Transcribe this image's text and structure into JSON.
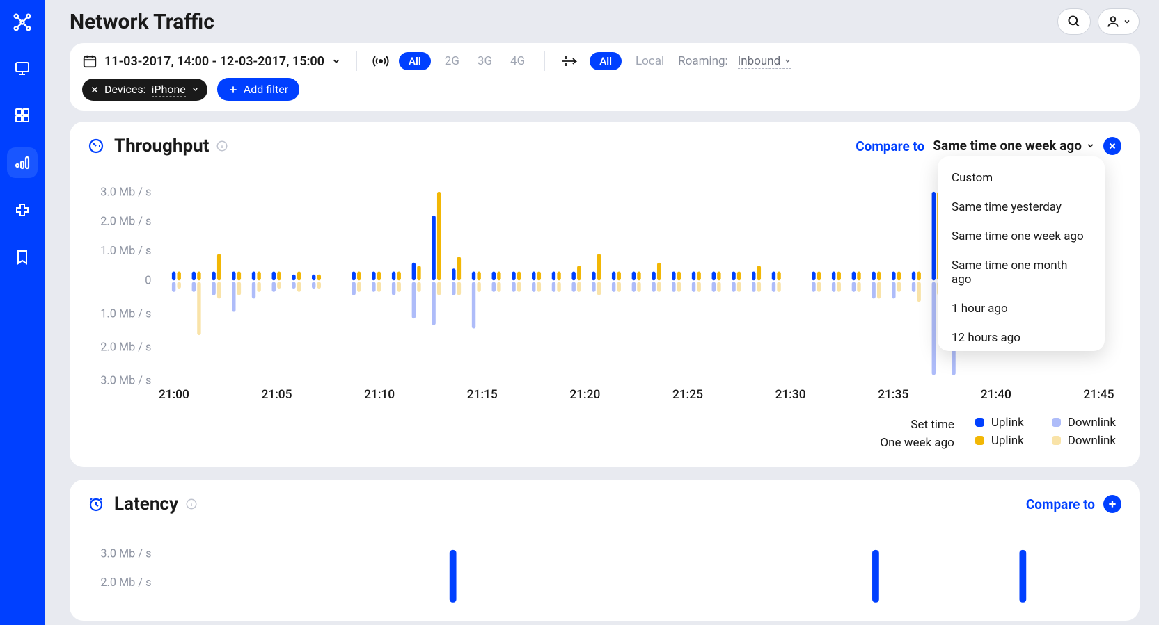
{
  "page_title": "Network Traffic",
  "date_range": "11-03-2017, 14:00 - 12-03-2017, 15:00",
  "network_filter": {
    "all": "All",
    "options": [
      "2G",
      "3G",
      "4G"
    ]
  },
  "roaming_filter": {
    "all": "All",
    "local": "Local",
    "roaming_label": "Roaming:",
    "roaming_value": "Inbound"
  },
  "device_filter": {
    "label": "Devices:",
    "value": "iPhone"
  },
  "add_filter": "Add filter",
  "throughput": {
    "title": "Throughput",
    "compare_label": "Compare to",
    "compare_value": "Same time one week ago",
    "legend": {
      "row1_label": "Set time",
      "row2_label": "One week ago",
      "uplink": "Uplink",
      "downlink": "Downlink"
    }
  },
  "latency": {
    "title": "Latency",
    "compare_label": "Compare to"
  },
  "dropdown_options": [
    "Custom",
    "Same time yesterday",
    "Same time one week ago",
    "Same time one month ago",
    "1 hour ago",
    "12 hours ago"
  ],
  "colors": {
    "blue": "#0040ff",
    "blue_light": "#aebcf9",
    "orange": "#f2b705",
    "orange_light": "#f9e3a8"
  },
  "chart_data": {
    "type": "bar",
    "title": "Throughput",
    "ylabel": "Mb / s",
    "ylim": [
      -3.0,
      3.0
    ],
    "y_ticks": [
      "3.0 Mb / s",
      "2.0 Mb / s",
      "1.0 Mb / s",
      "0",
      "1.0 Mb / s",
      "2.0 Mb / s",
      "3.0 Mb / s"
    ],
    "x_ticks": [
      "21:00",
      "21:05",
      "21:10",
      "21:15",
      "21:20",
      "21:25",
      "21:30",
      "21:35",
      "21:40",
      "21:45"
    ],
    "series": [
      {
        "name": "Set time Uplink",
        "color": "#0040ff"
      },
      {
        "name": "Set time Downlink",
        "color": "#aebcf9"
      },
      {
        "name": "One week ago Uplink",
        "color": "#f2b705"
      },
      {
        "name": "One week ago Downlink",
        "color": "#f9e3a8"
      }
    ],
    "points": [
      {
        "b_up": 0.3,
        "b_dn": 0.3,
        "o_up": 0.3,
        "o_dn": 0.2
      },
      {
        "b_up": 0.3,
        "b_dn": 0.3,
        "o_up": 0.3,
        "o_dn": 1.6
      },
      {
        "b_up": 0.3,
        "b_dn": 0.4,
        "o_up": 0.9,
        "o_dn": 0.5
      },
      {
        "b_up": 0.3,
        "b_dn": 0.9,
        "o_up": 0.3,
        "o_dn": 0.4
      },
      {
        "b_up": 0.3,
        "b_dn": 0.5,
        "o_up": 0.3,
        "o_dn": 0.3
      },
      {
        "b_up": 0.3,
        "b_dn": 0.3,
        "o_up": 0.3,
        "o_dn": 0.2
      },
      {
        "b_up": 0.2,
        "b_dn": 0.2,
        "o_up": 0.3,
        "o_dn": 0.3
      },
      {
        "b_up": 0.2,
        "b_dn": 0.2,
        "o_up": 0.2,
        "o_dn": 0.2
      },
      {
        "b_up": 0.0,
        "b_dn": 0.0,
        "o_up": 0.0,
        "o_dn": 0.0
      },
      {
        "b_up": 0.3,
        "b_dn": 0.4,
        "o_up": 0.3,
        "o_dn": 0.3
      },
      {
        "b_up": 0.3,
        "b_dn": 0.3,
        "o_up": 0.3,
        "o_dn": 0.3
      },
      {
        "b_up": 0.3,
        "b_dn": 0.4,
        "o_up": 0.3,
        "o_dn": 0.3
      },
      {
        "b_up": 0.6,
        "b_dn": 1.1,
        "o_up": 0.5,
        "o_dn": 0.3
      },
      {
        "b_up": 2.2,
        "b_dn": 1.3,
        "o_up": 3.0,
        "o_dn": 0.4
      },
      {
        "b_up": 0.4,
        "b_dn": 0.4,
        "o_up": 0.8,
        "o_dn": 0.4
      },
      {
        "b_up": 0.3,
        "b_dn": 1.4,
        "o_up": 0.3,
        "o_dn": 0.3
      },
      {
        "b_up": 0.3,
        "b_dn": 0.3,
        "o_up": 0.3,
        "o_dn": 0.3
      },
      {
        "b_up": 0.3,
        "b_dn": 0.3,
        "o_up": 0.3,
        "o_dn": 0.3
      },
      {
        "b_up": 0.3,
        "b_dn": 0.3,
        "o_up": 0.3,
        "o_dn": 0.3
      },
      {
        "b_up": 0.3,
        "b_dn": 0.3,
        "o_up": 0.3,
        "o_dn": 0.3
      },
      {
        "b_up": 0.3,
        "b_dn": 0.3,
        "o_up": 0.5,
        "o_dn": 0.3
      },
      {
        "b_up": 0.3,
        "b_dn": 0.3,
        "o_up": 0.9,
        "o_dn": 0.4
      },
      {
        "b_up": 0.3,
        "b_dn": 0.3,
        "o_up": 0.3,
        "o_dn": 0.3
      },
      {
        "b_up": 0.3,
        "b_dn": 0.3,
        "o_up": 0.3,
        "o_dn": 0.3
      },
      {
        "b_up": 0.3,
        "b_dn": 0.3,
        "o_up": 0.6,
        "o_dn": 0.3
      },
      {
        "b_up": 0.3,
        "b_dn": 0.3,
        "o_up": 0.3,
        "o_dn": 0.3
      },
      {
        "b_up": 0.3,
        "b_dn": 0.3,
        "o_up": 0.3,
        "o_dn": 0.3
      },
      {
        "b_up": 0.3,
        "b_dn": 0.3,
        "o_up": 0.3,
        "o_dn": 0.3
      },
      {
        "b_up": 0.3,
        "b_dn": 0.3,
        "o_up": 0.3,
        "o_dn": 0.3
      },
      {
        "b_up": 0.3,
        "b_dn": 0.3,
        "o_up": 0.5,
        "o_dn": 0.3
      },
      {
        "b_up": 0.3,
        "b_dn": 0.3,
        "o_up": 0.3,
        "o_dn": 0.3
      },
      {
        "b_up": 0.0,
        "b_dn": 0.0,
        "o_up": 0.0,
        "o_dn": 0.0
      },
      {
        "b_up": 0.3,
        "b_dn": 0.3,
        "o_up": 0.3,
        "o_dn": 0.3
      },
      {
        "b_up": 0.3,
        "b_dn": 0.3,
        "o_up": 0.3,
        "o_dn": 0.3
      },
      {
        "b_up": 0.3,
        "b_dn": 0.3,
        "o_up": 0.3,
        "o_dn": 0.3
      },
      {
        "b_up": 0.3,
        "b_dn": 0.5,
        "o_up": 0.3,
        "o_dn": 0.5
      },
      {
        "b_up": 0.3,
        "b_dn": 0.5,
        "o_up": 0.3,
        "o_dn": 0.3
      },
      {
        "b_up": 0.3,
        "b_dn": 0.3,
        "o_up": 0.3,
        "o_dn": 0.6
      },
      {
        "b_up": 3.0,
        "b_dn": 2.8,
        "o_up": 3.0,
        "o_dn": 0.4
      },
      {
        "b_up": 3.0,
        "b_dn": 2.8,
        "o_up": 2.2,
        "o_dn": 0.5
      },
      {
        "b_up": 0.3,
        "b_dn": 0.4,
        "o_up": 0.3,
        "o_dn": 0.4
      },
      {
        "b_up": 0.3,
        "b_dn": 0.3,
        "o_up": 0.3,
        "o_dn": 0.3
      },
      {
        "b_up": 0.3,
        "b_dn": 0.3,
        "o_up": 0.3,
        "o_dn": 0.3
      },
      {
        "b_up": 0.3,
        "b_dn": 0.3,
        "o_up": 0.3,
        "o_dn": 0.3
      },
      {
        "b_up": 0.3,
        "b_dn": 0.3,
        "o_up": 0.3,
        "o_dn": 0.3
      },
      {
        "b_up": 0.0,
        "b_dn": 0.0,
        "o_up": 0.0,
        "o_dn": 0.0
      },
      {
        "b_up": 0.3,
        "b_dn": 0.3,
        "o_up": 0.3,
        "o_dn": 0.2
      }
    ]
  },
  "latency_chart": {
    "y_ticks": [
      "3.0 Mb / s",
      "2.0 Mb / s"
    ]
  }
}
